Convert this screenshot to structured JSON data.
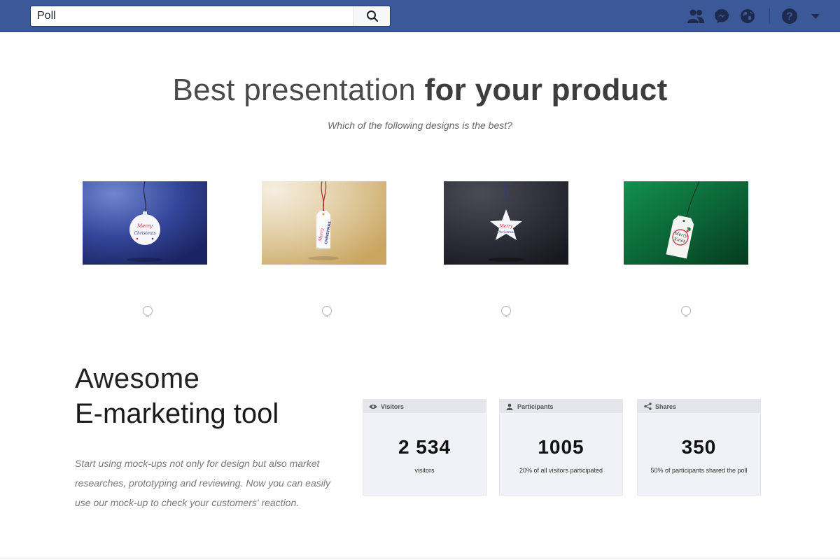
{
  "topbar": {
    "search": {
      "value": "Poll"
    },
    "icons": [
      "friends-icon",
      "messenger-icon",
      "globe-icon",
      "help-icon",
      "menu-caret-icon"
    ],
    "bg_color": "#3b5998"
  },
  "hero": {
    "title_light": "Best presentation",
    "title_bold": "for your product",
    "subtitle": "Which of the following designs is the best?"
  },
  "designs": [
    {
      "background": "blue",
      "tag_shape": "round",
      "tag_text": "Merry Christmas",
      "color": "#2f3f8e"
    },
    {
      "background": "gold",
      "tag_shape": "tag",
      "tag_text": "Merry Christmas",
      "color": "#d9c08e"
    },
    {
      "background": "dark",
      "tag_shape": "star",
      "tag_text": "Merry Christmas",
      "color": "#2a2b33"
    },
    {
      "background": "green",
      "tag_shape": "tag",
      "tag_text": "Merry Xmas",
      "color": "#0f6b3a"
    }
  ],
  "marketing": {
    "title_line1": "Awesome",
    "title_line2": "E-marketing tool",
    "description": "Start using mock-ups not only for design but also market researches, prototyping and reviewing. Now you can easily use our mock-up to check your customers' reaction."
  },
  "stats": [
    {
      "title": "Visitors",
      "icon": "eye-icon",
      "value": "2 534",
      "label": "visitors"
    },
    {
      "title": "Participants",
      "icon": "user-icon",
      "value": "1005",
      "label": "20% of all visitors participated"
    },
    {
      "title": "Shares",
      "icon": "share-icon",
      "value": "350",
      "label": "50% of participants shared the poll"
    }
  ]
}
